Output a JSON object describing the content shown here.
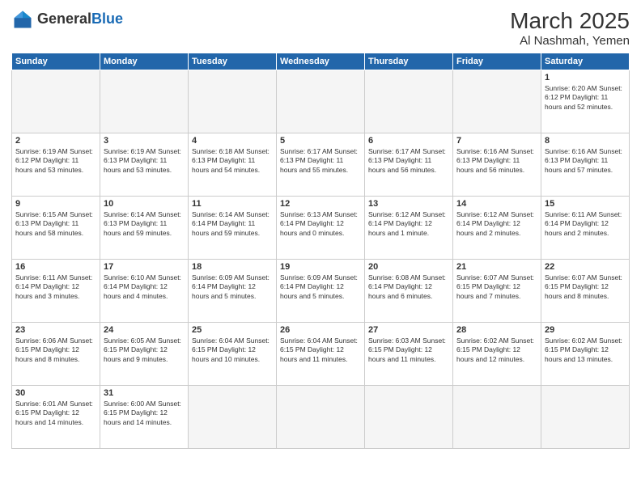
{
  "header": {
    "logo_general": "General",
    "logo_blue": "Blue",
    "month_title": "March 2025",
    "location": "Al Nashmah, Yemen"
  },
  "weekdays": [
    "Sunday",
    "Monday",
    "Tuesday",
    "Wednesday",
    "Thursday",
    "Friday",
    "Saturday"
  ],
  "weeks": [
    [
      {
        "day": "",
        "info": ""
      },
      {
        "day": "",
        "info": ""
      },
      {
        "day": "",
        "info": ""
      },
      {
        "day": "",
        "info": ""
      },
      {
        "day": "",
        "info": ""
      },
      {
        "day": "",
        "info": ""
      },
      {
        "day": "1",
        "info": "Sunrise: 6:20 AM\nSunset: 6:12 PM\nDaylight: 11 hours\nand 52 minutes."
      }
    ],
    [
      {
        "day": "2",
        "info": "Sunrise: 6:19 AM\nSunset: 6:12 PM\nDaylight: 11 hours\nand 53 minutes."
      },
      {
        "day": "3",
        "info": "Sunrise: 6:19 AM\nSunset: 6:13 PM\nDaylight: 11 hours\nand 53 minutes."
      },
      {
        "day": "4",
        "info": "Sunrise: 6:18 AM\nSunset: 6:13 PM\nDaylight: 11 hours\nand 54 minutes."
      },
      {
        "day": "5",
        "info": "Sunrise: 6:17 AM\nSunset: 6:13 PM\nDaylight: 11 hours\nand 55 minutes."
      },
      {
        "day": "6",
        "info": "Sunrise: 6:17 AM\nSunset: 6:13 PM\nDaylight: 11 hours\nand 56 minutes."
      },
      {
        "day": "7",
        "info": "Sunrise: 6:16 AM\nSunset: 6:13 PM\nDaylight: 11 hours\nand 56 minutes."
      },
      {
        "day": "8",
        "info": "Sunrise: 6:16 AM\nSunset: 6:13 PM\nDaylight: 11 hours\nand 57 minutes."
      }
    ],
    [
      {
        "day": "9",
        "info": "Sunrise: 6:15 AM\nSunset: 6:13 PM\nDaylight: 11 hours\nand 58 minutes."
      },
      {
        "day": "10",
        "info": "Sunrise: 6:14 AM\nSunset: 6:13 PM\nDaylight: 11 hours\nand 59 minutes."
      },
      {
        "day": "11",
        "info": "Sunrise: 6:14 AM\nSunset: 6:14 PM\nDaylight: 11 hours\nand 59 minutes."
      },
      {
        "day": "12",
        "info": "Sunrise: 6:13 AM\nSunset: 6:14 PM\nDaylight: 12 hours\nand 0 minutes."
      },
      {
        "day": "13",
        "info": "Sunrise: 6:12 AM\nSunset: 6:14 PM\nDaylight: 12 hours\nand 1 minute."
      },
      {
        "day": "14",
        "info": "Sunrise: 6:12 AM\nSunset: 6:14 PM\nDaylight: 12 hours\nand 2 minutes."
      },
      {
        "day": "15",
        "info": "Sunrise: 6:11 AM\nSunset: 6:14 PM\nDaylight: 12 hours\nand 2 minutes."
      }
    ],
    [
      {
        "day": "16",
        "info": "Sunrise: 6:11 AM\nSunset: 6:14 PM\nDaylight: 12 hours\nand 3 minutes."
      },
      {
        "day": "17",
        "info": "Sunrise: 6:10 AM\nSunset: 6:14 PM\nDaylight: 12 hours\nand 4 minutes."
      },
      {
        "day": "18",
        "info": "Sunrise: 6:09 AM\nSunset: 6:14 PM\nDaylight: 12 hours\nand 5 minutes."
      },
      {
        "day": "19",
        "info": "Sunrise: 6:09 AM\nSunset: 6:14 PM\nDaylight: 12 hours\nand 5 minutes."
      },
      {
        "day": "20",
        "info": "Sunrise: 6:08 AM\nSunset: 6:14 PM\nDaylight: 12 hours\nand 6 minutes."
      },
      {
        "day": "21",
        "info": "Sunrise: 6:07 AM\nSunset: 6:15 PM\nDaylight: 12 hours\nand 7 minutes."
      },
      {
        "day": "22",
        "info": "Sunrise: 6:07 AM\nSunset: 6:15 PM\nDaylight: 12 hours\nand 8 minutes."
      }
    ],
    [
      {
        "day": "23",
        "info": "Sunrise: 6:06 AM\nSunset: 6:15 PM\nDaylight: 12 hours\nand 8 minutes."
      },
      {
        "day": "24",
        "info": "Sunrise: 6:05 AM\nSunset: 6:15 PM\nDaylight: 12 hours\nand 9 minutes."
      },
      {
        "day": "25",
        "info": "Sunrise: 6:04 AM\nSunset: 6:15 PM\nDaylight: 12 hours\nand 10 minutes."
      },
      {
        "day": "26",
        "info": "Sunrise: 6:04 AM\nSunset: 6:15 PM\nDaylight: 12 hours\nand 11 minutes."
      },
      {
        "day": "27",
        "info": "Sunrise: 6:03 AM\nSunset: 6:15 PM\nDaylight: 12 hours\nand 11 minutes."
      },
      {
        "day": "28",
        "info": "Sunrise: 6:02 AM\nSunset: 6:15 PM\nDaylight: 12 hours\nand 12 minutes."
      },
      {
        "day": "29",
        "info": "Sunrise: 6:02 AM\nSunset: 6:15 PM\nDaylight: 12 hours\nand 13 minutes."
      }
    ],
    [
      {
        "day": "30",
        "info": "Sunrise: 6:01 AM\nSunset: 6:15 PM\nDaylight: 12 hours\nand 14 minutes."
      },
      {
        "day": "31",
        "info": "Sunrise: 6:00 AM\nSunset: 6:15 PM\nDaylight: 12 hours\nand 14 minutes."
      },
      {
        "day": "",
        "info": ""
      },
      {
        "day": "",
        "info": ""
      },
      {
        "day": "",
        "info": ""
      },
      {
        "day": "",
        "info": ""
      },
      {
        "day": "",
        "info": ""
      }
    ]
  ]
}
